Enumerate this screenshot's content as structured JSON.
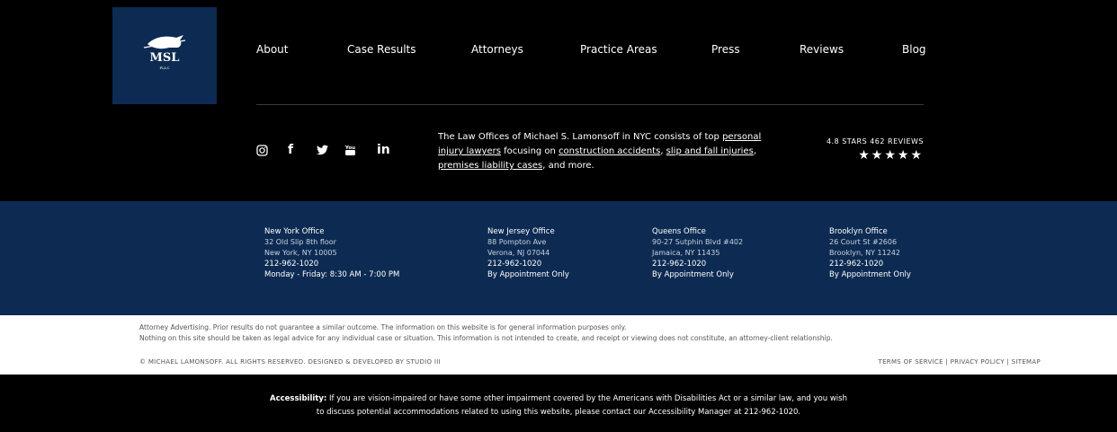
{
  "logo": {
    "text": "MSL",
    "sub": "PLLC"
  },
  "nav": [
    "About",
    "Case Results",
    "Attorneys",
    "Practice Areas",
    "Press",
    "Reviews",
    "Blog"
  ],
  "social": [
    {
      "icon": "instagram-icon",
      "glyph": "◎"
    },
    {
      "icon": "facebook-icon",
      "glyph": "f"
    },
    {
      "icon": "twitter-icon",
      "glyph": "🐦"
    },
    {
      "icon": "youtube-icon",
      "glyph": "You"
    },
    {
      "icon": "linkedin-icon",
      "glyph": "in"
    }
  ],
  "description": {
    "p1": "The Law Offices of Michael S. Lamonsoff in NYC consists of top ",
    "l1": "personal injury lawyers",
    "p2": " focusing on ",
    "l2": "construction accidents",
    "p3": ", ",
    "l3": "slip and fall injuries",
    "p4": ", ",
    "l4": "premises liability cases",
    "p5": ", and more."
  },
  "rating": {
    "text": "4.8 STARS 462 REVIEWS",
    "stars": "★★★★★",
    "value": 4.8
  },
  "offices": [
    {
      "name": "New York Office",
      "line1": "32 Old Slip 8th floor",
      "line2": "New York, NY 10005",
      "phone": "212-962-1020",
      "hours": "Monday - Friday: 8:30 AM - 7:00 PM"
    },
    {
      "name": "New Jersey Office",
      "line1": "88 Pompton Ave",
      "line2": "Verona, NJ 07044",
      "phone": "212-962-1020",
      "hours": "By Appointment Only"
    },
    {
      "name": "Queens Office",
      "line1": "90-27 Sutphin Blvd #402",
      "line2": "Jamaica, NY 11435",
      "phone": "212-962-1020",
      "hours": "By Appointment Only"
    },
    {
      "name": "Brooklyn Office",
      "line1": "26 Court St #2606",
      "line2": "Brooklyn, NY 11242",
      "phone": "212-962-1020",
      "hours": "By Appointment Only"
    }
  ],
  "legal": {
    "line1": "Attorney Advertising. Prior results do not guarantee a similar outcome. The information on this website is for general information purposes only.",
    "line2": "Nothing on this site should be taken as legal advice for any individual case or situation. This information is not intended to create, and receipt or viewing does not constitute, an attorney-client relationship."
  },
  "footer": {
    "copyright": "© MICHAEL LAMONSOFF. ALL RIGHTS RESERVED. DESIGNED & DEVELOPED BY STUDIO III",
    "terms": "TERMS OF SERVICE",
    "privacy": "PRIVACY POLICY",
    "sitemap": "SITEMAP",
    "sep": " | "
  },
  "accessibility": {
    "label": "Accessibility:",
    "text1": " If you are vision-impaired or have some other impairment covered by the Americans with Disabilities Act or a similar law, and you wish",
    "text2": "to discuss potential accommodations related to using this website, please contact our Accessibility Manager at 212-962-1020."
  },
  "colors": {
    "navy": "#0d2b52",
    "black": "#000000"
  }
}
